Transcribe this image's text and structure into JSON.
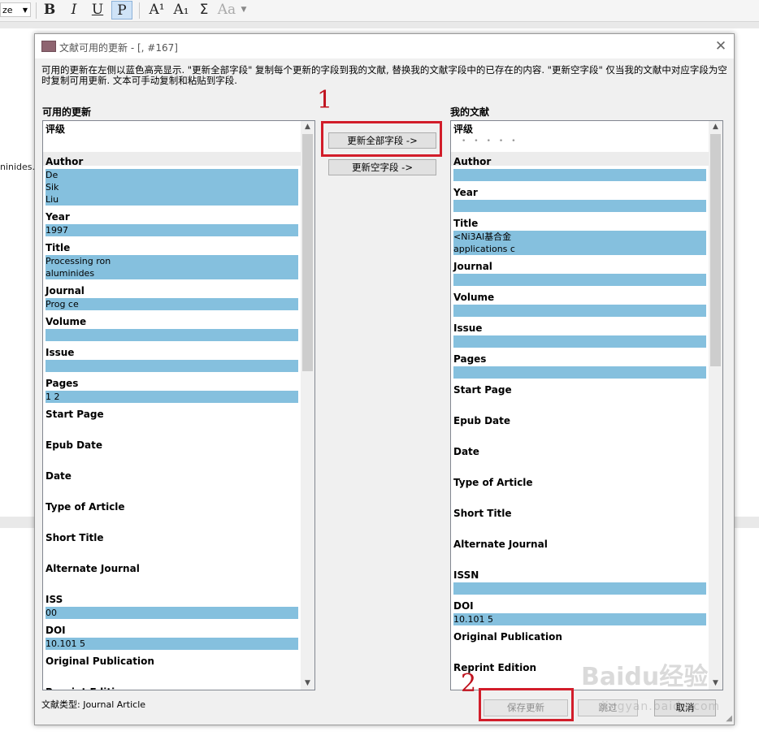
{
  "toolbar": {
    "size_value": "ze",
    "bold": "B",
    "italic": "I",
    "underline": "U",
    "plain": "P",
    "superscript": "A¹",
    "subscript": "A₁",
    "symbol": "Σ",
    "case": "Aa"
  },
  "background": {
    "file_fragment": "ninides.p"
  },
  "dialog": {
    "title": "文献可用的更新 - [,  #167]",
    "instructions": "可用的更新在左侧以蓝色高亮显示. \"更新全部字段\" 复制每个更新的字段到我的文献, 替换我的文献字段中的已存在的内容. \"更新空字段\" 仅当我的文献中对应字段为空时复制可用更新. 文本可手动复制和粘贴到字段.",
    "left_header": "可用的更新",
    "right_header": "我的文献",
    "update_all_label": "更新全部字段 ->",
    "update_empty_label": "更新空字段 ->",
    "reference_type": "文献类型: Journal Article",
    "save_label": "保存更新",
    "skip_label": "跳过",
    "cancel_label": "取消"
  },
  "annotations": {
    "marker_1": "1",
    "marker_2": "2"
  },
  "watermark": {
    "main": "Baidu经验",
    "sub": "jingyan.baidu.com"
  },
  "left_fields": [
    {
      "label": "评级",
      "value": []
    },
    {
      "label": "Author",
      "value": [
        "De",
        "Sik",
        "Liu"
      ]
    },
    {
      "label": "Year",
      "value": [
        "1997"
      ]
    },
    {
      "label": "Title",
      "value": [
        "Processing                                              ron",
        "aluminides"
      ]
    },
    {
      "label": "Journal",
      "value": [
        "Prog                            ce"
      ]
    },
    {
      "label": "Volume",
      "value": [
        ""
      ]
    },
    {
      "label": "Issue",
      "value": [
        ""
      ]
    },
    {
      "label": "Pages",
      "value": [
        "1        2"
      ]
    },
    {
      "label": "Start Page",
      "value": []
    },
    {
      "label": "Epub Date",
      "value": []
    },
    {
      "label": "Date",
      "value": []
    },
    {
      "label": "Type of Article",
      "value": []
    },
    {
      "label": "Short Title",
      "value": []
    },
    {
      "label": "Alternate Journal",
      "value": []
    },
    {
      "label": "ISS",
      "value": [
        "00"
      ]
    },
    {
      "label": "DOI",
      "value": [
        "10.101                              5"
      ]
    },
    {
      "label": "Original Publication",
      "value": []
    },
    {
      "label": "Reprint Edition",
      "value": []
    }
  ],
  "right_fields": [
    {
      "label": "评级",
      "value": []
    },
    {
      "label": "Author",
      "value": [
        ""
      ]
    },
    {
      "label": "Year",
      "value": [
        ""
      ]
    },
    {
      "label": "Title",
      "value": [
        "<Ni3Al基合金",
        "applications c"
      ]
    },
    {
      "label": "Journal",
      "value": [
        ""
      ]
    },
    {
      "label": "Volume",
      "value": [
        ""
      ]
    },
    {
      "label": "Issue",
      "value": [
        ""
      ]
    },
    {
      "label": "Pages",
      "value": [
        ""
      ]
    },
    {
      "label": "Start Page",
      "value": []
    },
    {
      "label": "Epub Date",
      "value": []
    },
    {
      "label": "Date",
      "value": []
    },
    {
      "label": "Type of Article",
      "value": []
    },
    {
      "label": "Short Title",
      "value": []
    },
    {
      "label": "Alternate Journal",
      "value": []
    },
    {
      "label": "ISSN",
      "value": [
        ""
      ]
    },
    {
      "label": "DOI",
      "value": [
        "10.101                              5"
      ]
    },
    {
      "label": "Original Publication",
      "value": []
    },
    {
      "label": "Reprint Edition",
      "value": []
    }
  ]
}
